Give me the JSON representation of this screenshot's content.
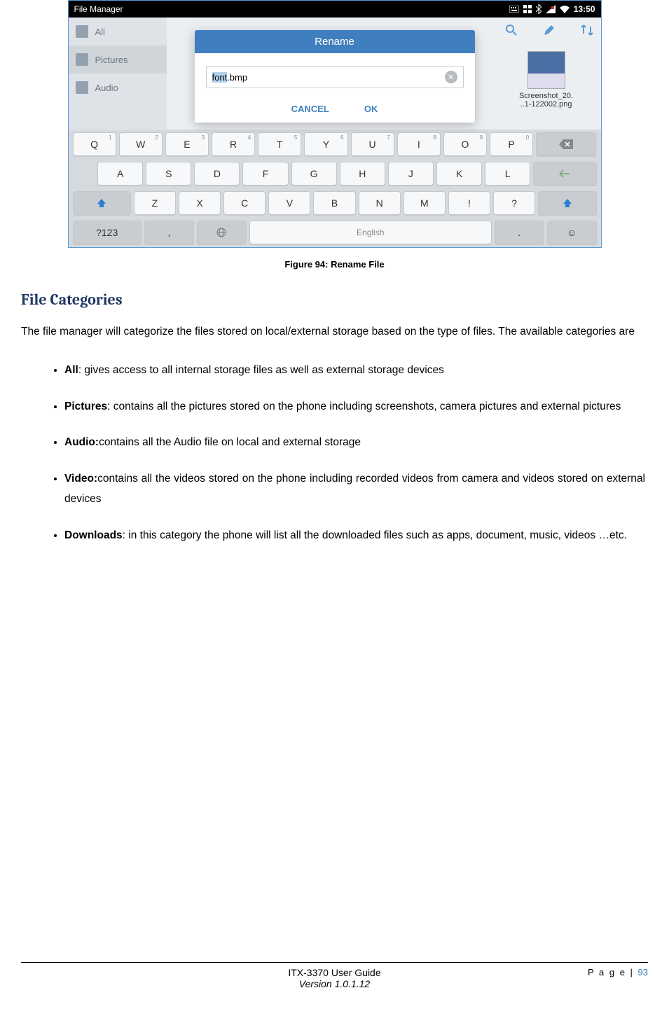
{
  "screenshot": {
    "status_bar": {
      "app_title": "File Manager",
      "time": "13:50"
    },
    "sidebar": {
      "items": [
        {
          "label": "All"
        },
        {
          "label": "Pictures"
        },
        {
          "label": "Audio"
        }
      ]
    },
    "thumbnail": {
      "line1": "Screenshot_20.",
      "line2": "..1-122002.png"
    },
    "dialog": {
      "title": "Rename",
      "input_selected": "font",
      "input_rest": ".bmp",
      "cancel": "CANCEL",
      "ok": "OK"
    },
    "keyboard": {
      "row1": [
        {
          "k": "Q",
          "n": "1"
        },
        {
          "k": "W",
          "n": "2"
        },
        {
          "k": "E",
          "n": "3"
        },
        {
          "k": "R",
          "n": "4"
        },
        {
          "k": "T",
          "n": "5"
        },
        {
          "k": "Y",
          "n": "6"
        },
        {
          "k": "U",
          "n": "7"
        },
        {
          "k": "I",
          "n": "8"
        },
        {
          "k": "O",
          "n": "9"
        },
        {
          "k": "P",
          "n": "0"
        }
      ],
      "row2": [
        "A",
        "S",
        "D",
        "F",
        "G",
        "H",
        "J",
        "K",
        "L"
      ],
      "row3": [
        "Z",
        "X",
        "C",
        "V",
        "B",
        "N",
        "M",
        "!",
        "?"
      ],
      "sym": "?123",
      "space": "English"
    }
  },
  "caption": "Figure 94: Rename File",
  "heading": "File Categories",
  "intro": "The file manager will categorize the files stored on local/external storage based on the type of files. The available categories are",
  "bullets": [
    {
      "bold": "All",
      "rest": ": gives access to all internal storage files as well as external storage devices"
    },
    {
      "bold": "Pictures",
      "rest": ": contains all the pictures stored on the phone including screenshots, camera pictures and external pictures"
    },
    {
      "bold": "Audio:",
      "rest": "contains all the Audio file on local and external storage"
    },
    {
      "bold": "Video:",
      "rest": "contains all the videos stored on the phone including recorded videos from camera and videos stored on external devices"
    },
    {
      "bold": "Downloads",
      "rest": ": in this category the phone will list all the downloaded files such as apps, document, music, videos …etc."
    }
  ],
  "footer": {
    "guide": "ITX-3370 User Guide",
    "version": "Version 1.0.1.12",
    "page_label": "P a g e | ",
    "page_num": "93"
  }
}
